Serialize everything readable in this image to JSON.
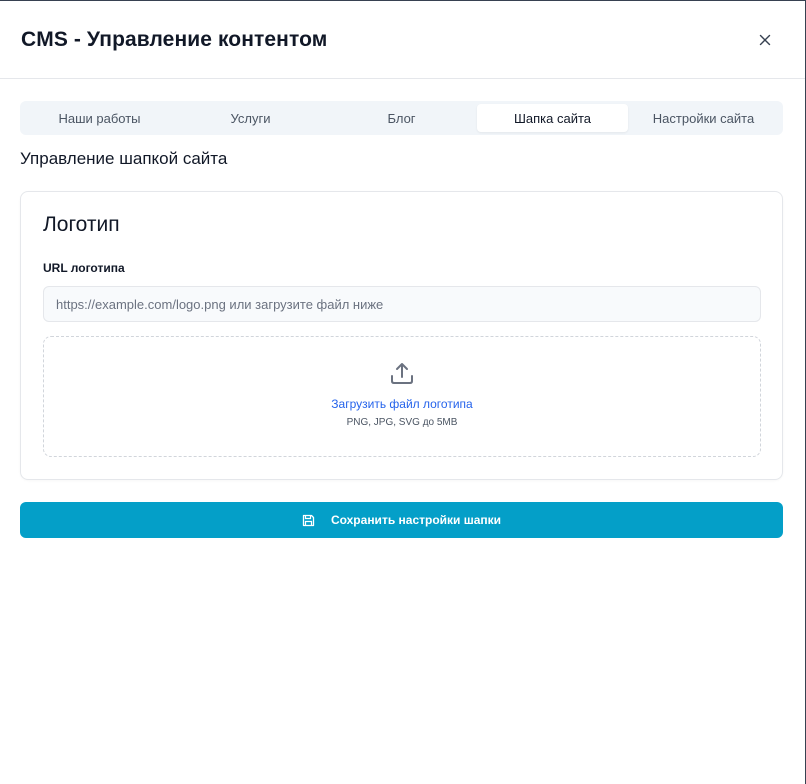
{
  "dialog": {
    "title": "CMS - Управление контентом",
    "close_icon": "close-icon"
  },
  "tabs": [
    {
      "label": "Наши работы",
      "active": false
    },
    {
      "label": "Услуги",
      "active": false
    },
    {
      "label": "Блог",
      "active": false
    },
    {
      "label": "Шапка сайта",
      "active": true
    },
    {
      "label": "Настройки сайта",
      "active": false
    }
  ],
  "section": {
    "title": "Управление шапкой сайта"
  },
  "logo_card": {
    "title": "Логотип",
    "url_label": "URL логотипа",
    "url_value": "",
    "url_placeholder": "https://example.com/logo.png или загрузите файл ниже",
    "upload_icon": "upload-icon",
    "upload_link": "Загрузить файл логотипа",
    "upload_hint": "PNG, JPG, SVG до 5MB"
  },
  "save_button": {
    "label": "Сохранить настройки шапки",
    "icon": "save-icon"
  },
  "colors": {
    "accent": "#049fc8",
    "link": "#2563eb",
    "tabs_bg": "#f1f5f9"
  }
}
